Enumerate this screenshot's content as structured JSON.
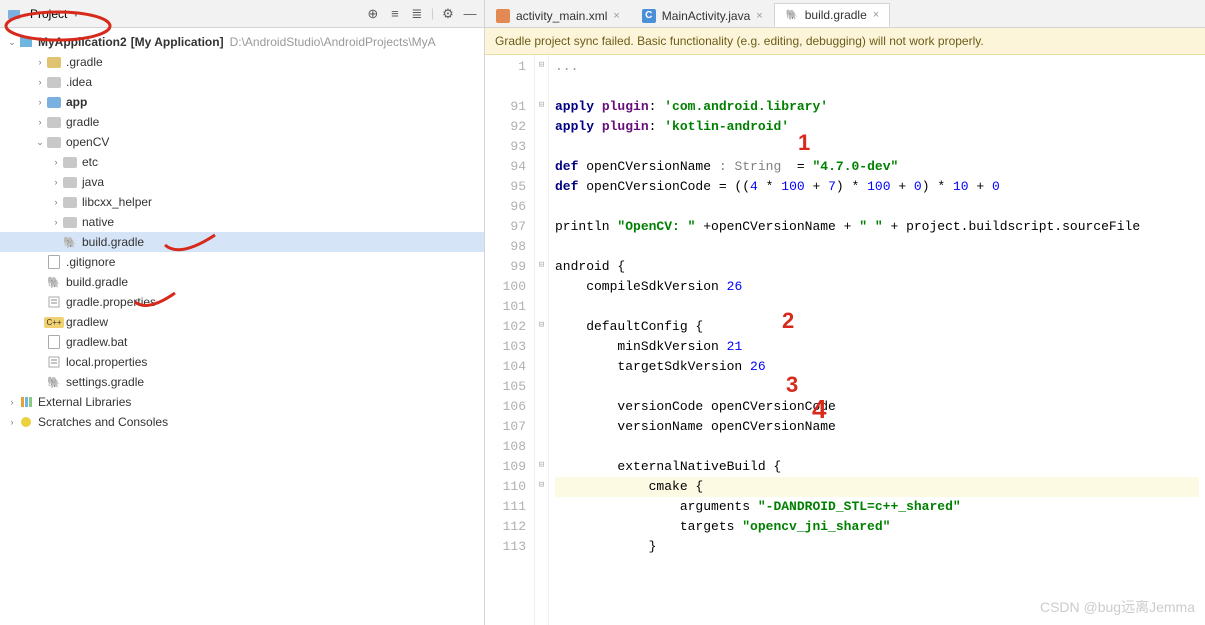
{
  "project_header": {
    "label": "Project",
    "icons": [
      "target",
      "expand",
      "collapse",
      "divider",
      "gear",
      "minimize"
    ]
  },
  "project_path_text": "D:\\AndroidStudio\\AndroidProjects\\MyA",
  "project_root_label": "MyApplication2",
  "project_root_suffix": "[My Application]",
  "tree": [
    {
      "label": ".gradle",
      "indent": 2,
      "icon": "folder-orange",
      "arrow": "›"
    },
    {
      "label": ".idea",
      "indent": 2,
      "icon": "folder-gray",
      "arrow": "›"
    },
    {
      "label": "app",
      "indent": 2,
      "icon": "folder-blue",
      "arrow": "›",
      "bold": true
    },
    {
      "label": "gradle",
      "indent": 2,
      "icon": "folder-gray",
      "arrow": "›"
    },
    {
      "label": "openCV",
      "indent": 2,
      "icon": "folder-gray",
      "arrow": "⌄"
    },
    {
      "label": "etc",
      "indent": 3,
      "icon": "folder-gray",
      "arrow": "›"
    },
    {
      "label": "java",
      "indent": 3,
      "icon": "folder-gray",
      "arrow": "›"
    },
    {
      "label": "libcxx_helper",
      "indent": 3,
      "icon": "folder-gray",
      "arrow": "›"
    },
    {
      "label": "native",
      "indent": 3,
      "icon": "folder-gray",
      "arrow": "›"
    },
    {
      "label": "build.gradle",
      "indent": 3,
      "icon": "gradle",
      "selected": true
    },
    {
      "label": ".gitignore",
      "indent": 2,
      "icon": "file"
    },
    {
      "label": "build.gradle",
      "indent": 2,
      "icon": "gradle"
    },
    {
      "label": "gradle.properties",
      "indent": 2,
      "icon": "props"
    },
    {
      "label": "gradlew",
      "indent": 2,
      "icon": "cpp"
    },
    {
      "label": "gradlew.bat",
      "indent": 2,
      "icon": "file"
    },
    {
      "label": "local.properties",
      "indent": 2,
      "icon": "props"
    },
    {
      "label": "settings.gradle",
      "indent": 2,
      "icon": "gradle"
    }
  ],
  "external_libs": "External Libraries",
  "scratches": "Scratches and Consoles",
  "tabs": [
    {
      "label": "activity_main.xml",
      "icon_bg": "#e38a54",
      "active": false
    },
    {
      "label": "MainActivity.java",
      "icon_bg": "#4a90d9",
      "icon_letter": "C",
      "active": false
    },
    {
      "label": "build.gradle",
      "icon_color": "#85a98f",
      "active": true
    }
  ],
  "notification": "Gradle project sync failed. Basic functionality (e.g. editing, debugging) will not work properly.",
  "code": {
    "line_start": 1,
    "lines": [
      {
        "n": 1,
        "folded": "..."
      },
      {
        "n": "",
        "spacer": true
      },
      {
        "n": 91,
        "tokens": [
          [
            "kw",
            "apply"
          ],
          [
            "plain",
            " "
          ],
          [
            "ident",
            "plugin"
          ],
          [
            "plain",
            ": "
          ],
          [
            "str",
            "'com.android.library'"
          ]
        ]
      },
      {
        "n": 92,
        "tokens": [
          [
            "kw",
            "apply"
          ],
          [
            "plain",
            " "
          ],
          [
            "ident",
            "plugin"
          ],
          [
            "plain",
            ": "
          ],
          [
            "str",
            "'kotlin-android'"
          ]
        ]
      },
      {
        "n": 93,
        "tokens": []
      },
      {
        "n": 94,
        "tokens": [
          [
            "kw",
            "def"
          ],
          [
            "plain",
            " openCVersionName "
          ],
          [
            "type",
            ": String"
          ],
          [
            "plain",
            "  = "
          ],
          [
            "str",
            "\"4.7.0-dev\""
          ]
        ]
      },
      {
        "n": 95,
        "tokens": [
          [
            "kw",
            "def"
          ],
          [
            "plain",
            " openCVersionCode = (("
          ],
          [
            "num",
            "4"
          ],
          [
            "plain",
            " * "
          ],
          [
            "num",
            "100"
          ],
          [
            "plain",
            " + "
          ],
          [
            "num",
            "7"
          ],
          [
            "plain",
            ") * "
          ],
          [
            "num",
            "100"
          ],
          [
            "plain",
            " + "
          ],
          [
            "num",
            "0"
          ],
          [
            "plain",
            ") * "
          ],
          [
            "num",
            "10"
          ],
          [
            "plain",
            " + "
          ],
          [
            "num",
            "0"
          ]
        ]
      },
      {
        "n": 96,
        "tokens": []
      },
      {
        "n": 97,
        "tokens": [
          [
            "plain",
            "println "
          ],
          [
            "str",
            "\"OpenCV: \""
          ],
          [
            "plain",
            " +openCVersionName + "
          ],
          [
            "str",
            "\" \""
          ],
          [
            "plain",
            " + project.buildscript.sourceFile"
          ]
        ]
      },
      {
        "n": 98,
        "tokens": []
      },
      {
        "n": 99,
        "tokens": [
          [
            "plain",
            "android {"
          ]
        ]
      },
      {
        "n": 100,
        "tokens": [
          [
            "plain",
            "    compileSdkVersion "
          ],
          [
            "num",
            "26"
          ]
        ]
      },
      {
        "n": 101,
        "tokens": []
      },
      {
        "n": 102,
        "tokens": [
          [
            "plain",
            "    defaultConfig {"
          ]
        ]
      },
      {
        "n": 103,
        "tokens": [
          [
            "plain",
            "        minSdkVersion "
          ],
          [
            "num",
            "21"
          ]
        ]
      },
      {
        "n": 104,
        "tokens": [
          [
            "plain",
            "        targetSdkVersion "
          ],
          [
            "num",
            "26"
          ]
        ]
      },
      {
        "n": 105,
        "tokens": []
      },
      {
        "n": 106,
        "tokens": [
          [
            "plain",
            "        versionCode openCVersionCode"
          ]
        ]
      },
      {
        "n": 107,
        "tokens": [
          [
            "plain",
            "        versionName openCVersionName"
          ]
        ]
      },
      {
        "n": 108,
        "tokens": []
      },
      {
        "n": 109,
        "tokens": [
          [
            "plain",
            "        externalNativeBuild {"
          ]
        ]
      },
      {
        "n": 110,
        "hl": true,
        "tokens": [
          [
            "plain",
            "            cmake {"
          ]
        ]
      },
      {
        "n": 111,
        "tokens": [
          [
            "plain",
            "                arguments "
          ],
          [
            "str",
            "\"-DANDROID_STL=c++_shared\""
          ]
        ]
      },
      {
        "n": 112,
        "tokens": [
          [
            "plain",
            "                targets "
          ],
          [
            "str",
            "\"opencv_jni_shared\""
          ]
        ]
      },
      {
        "n": 113,
        "tokens": [
          [
            "plain",
            "            }"
          ]
        ]
      }
    ]
  },
  "annotations": {
    "a1": "1",
    "a2": "2",
    "a3": "3",
    "a4": "4"
  },
  "watermark": "CSDN @bug远离Jemma"
}
